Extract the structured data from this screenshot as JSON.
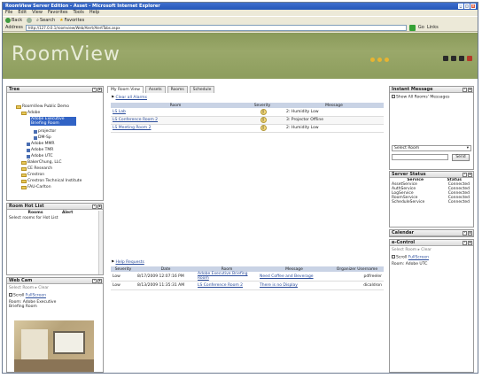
{
  "window": {
    "title": "RoomView Server Edition - Asset - Microsoft Internet Explorer"
  },
  "menu": [
    "File",
    "Edit",
    "View",
    "Favorites",
    "Tools",
    "Help"
  ],
  "toolbar": {
    "back": "Back",
    "search": "Search",
    "favorites": "Favorites"
  },
  "address": {
    "label": "Address",
    "value": "http://127.0.0.1/roomview/Web/Alert/AlertTabs.aspx",
    "go": "Go",
    "links": "Links"
  },
  "app": {
    "logo": "RoomView"
  },
  "tree": {
    "title": "Tree",
    "items": [
      {
        "label": "RoomView Public Demo"
      },
      {
        "label": "Adobe"
      },
      {
        "label": "Adobe Executive Briefing Room"
      },
      {
        "label": "projector"
      },
      {
        "label": "DM-Sp"
      },
      {
        "label": "Adobe MMR"
      },
      {
        "label": "Adobe TMR"
      },
      {
        "label": "Adobe UTC"
      },
      {
        "label": "BakerChung, LLC"
      },
      {
        "label": "CE Research"
      },
      {
        "label": "Crestron"
      },
      {
        "label": "Crestron Technical Institute"
      },
      {
        "label": "FAU-Carlton"
      }
    ]
  },
  "hotlist": {
    "title": "Room Hot List",
    "col_rooms": "Rooms",
    "col_alert": "Alert",
    "note": "Select rooms for Hot List"
  },
  "webcam": {
    "title": "Web Cam",
    "select": "Select Room",
    "clear": "Clear",
    "scroll_label": "Scroll",
    "fullscreen": "FullScreen",
    "room": "Room: Adobe Executive Briefing Room"
  },
  "main": {
    "tabs": [
      "My Room View",
      "Assets",
      "Rooms",
      "Schedule"
    ],
    "clear_alarms": "Clear all Alarms",
    "alarm_table": {
      "headers": [
        "Room",
        "Severity",
        "Message"
      ],
      "rows": [
        {
          "room": "LS Lab",
          "severity": "!",
          "message": "2: Humidity Low"
        },
        {
          "room": "LS Conference Room 2",
          "severity": "!",
          "message": "3: Projector Offline"
        },
        {
          "room": "LS Meeting Room 2",
          "severity": "!",
          "message": "2: Humidity Low"
        }
      ]
    },
    "help_requests": "Help Requests",
    "help_table": {
      "headers": [
        "Severity",
        "Date",
        "Room",
        "Message",
        "Organizer Username"
      ],
      "rows": [
        {
          "severity": "Low",
          "date": "8/17/2009 12:07:16 PM",
          "room": "Adobe Executive Briefing Room",
          "message": "Need Coffee and Beverage",
          "user": "pdfreeler"
        },
        {
          "severity": "Low",
          "date": "8/13/2009 11:35:31 AM",
          "room": "LS Conference Room 2",
          "message": "There is no Display",
          "user": "dicaldron"
        }
      ]
    }
  },
  "instant_message": {
    "title": "Instant Message",
    "show_all": "Show All Rooms' Messages",
    "select_room": "Select Room",
    "send": "Send"
  },
  "server_status": {
    "title": "Server Status",
    "headers": [
      "Service",
      "Status"
    ],
    "rows": [
      {
        "service": "AssetService",
        "status": "Connected"
      },
      {
        "service": "AuthService",
        "status": "Connected"
      },
      {
        "service": "LogService",
        "status": "Connected"
      },
      {
        "service": "RoomService",
        "status": "Connected"
      },
      {
        "service": "ScheduleService",
        "status": "Connected"
      }
    ]
  },
  "calendar": {
    "title": "Calendar"
  },
  "econtrol": {
    "title": "e-Control",
    "select": "Select Room",
    "clear": "Clear",
    "scroll_label": "Scroll",
    "fullscreen": "FullScreen",
    "room": "Room: Adobe UTC"
  },
  "colors": {
    "accent": "#2a4c9b",
    "header_bg": "#8a9a5a",
    "table_head": "#c9d3e5",
    "selected": "#3163c5"
  }
}
